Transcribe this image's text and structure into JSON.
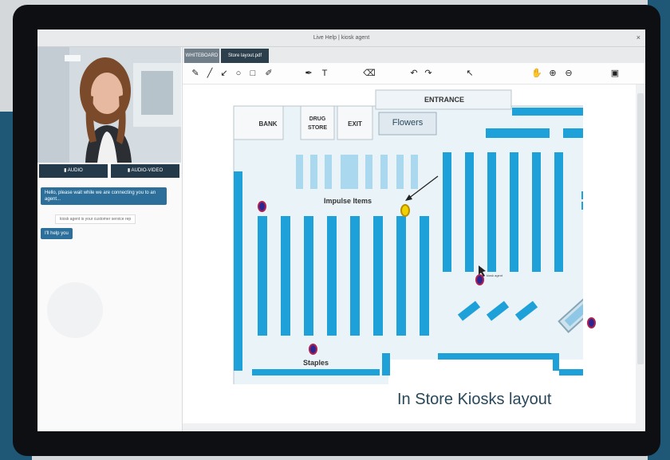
{
  "window": {
    "title": "Live Help | kiosk agent",
    "close_glyph": "×"
  },
  "call": {
    "audio_label": "▮ AUDIO",
    "audio_video_label": "▮ AUDIO-VIDEO"
  },
  "chat": {
    "messages": [
      {
        "text": "Hello, please wait while we are connecting you to an agent...",
        "type": "bot"
      },
      {
        "text": "kiosk agent is your customer service rep",
        "type": "system"
      },
      {
        "text": "I'll help you",
        "type": "agent"
      }
    ]
  },
  "tabs": [
    {
      "label": "WHITEBOARD",
      "active": false
    },
    {
      "label": "Store layout.pdf",
      "active": true
    }
  ],
  "toolbar": {
    "tools": [
      "pencil-icon",
      "line-icon",
      "arrow-icon",
      "circle-icon",
      "square-icon",
      "color-picker-icon",
      "marker-icon",
      "text-icon",
      "eraser-icon",
      "undo-icon",
      "redo-icon",
      "pointer-icon",
      "hand-icon",
      "zoom-in-icon",
      "zoom-out-icon",
      "save-icon"
    ],
    "glyphs": {
      "pencil": "✎",
      "line": "╱",
      "arrow": "↙",
      "circle": "○",
      "square": "□",
      "color": "✐",
      "marker": "✒",
      "text": "T",
      "eraser": "⌫",
      "undo": "↶",
      "redo": "↷",
      "pointer": "↖",
      "hand": "✋",
      "zoom_in": "⊕",
      "zoom_out": "⊖",
      "save": "▣"
    }
  },
  "floorplan": {
    "entrance": "ENTRANCE",
    "bank": "BANK",
    "drug_store_line1": "DRUG",
    "drug_store_line2": "STORE",
    "exit": "EXIT",
    "flowers": "Flowers",
    "impulse_items": "Impulse Items",
    "staples": "Staples",
    "caption": "In Store Kiosks layout",
    "cursor_tag": "kiosk agent"
  },
  "colors": {
    "shelf": "#1ea0d8",
    "kiosk_dot": "#2a2590",
    "highlight_dot": "#f1d200",
    "chat_bubble": "#2b6f9a",
    "bezel": "#0d0f12"
  }
}
